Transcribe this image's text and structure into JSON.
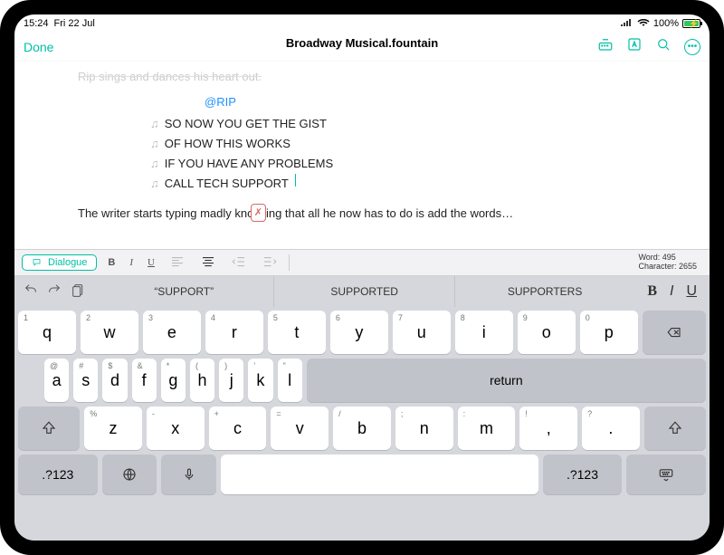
{
  "status": {
    "time": "15:24",
    "date": "Fri 22 Jul",
    "battery_pct": "100%"
  },
  "appbar": {
    "done": "Done",
    "title": "Broadway Musical.fountain"
  },
  "doc": {
    "fade_line": "Rip sings and dances his heart out.",
    "character": "@RIP",
    "lyrics": [
      "SO NOW YOU GET THE GIST",
      "OF HOW THIS WORKS",
      "IF YOU HAVE ANY PROBLEMS",
      "CALL TECH SUPPORT"
    ],
    "action": "The writer starts typing madly knowing that all he now has to do is add the words…"
  },
  "toolbar2": {
    "dialog_label": "Dialogue",
    "word_label": "Word: 495",
    "char_label": "Character: 2655"
  },
  "suggestions": [
    "“SUPPORT”",
    "SUPPORTED",
    "SUPPORTERS"
  ],
  "keys": {
    "row1": [
      {
        "sub": "1",
        "main": "q"
      },
      {
        "sub": "2",
        "main": "w"
      },
      {
        "sub": "3",
        "main": "e"
      },
      {
        "sub": "4",
        "main": "r"
      },
      {
        "sub": "5",
        "main": "t"
      },
      {
        "sub": "6",
        "main": "y"
      },
      {
        "sub": "7",
        "main": "u"
      },
      {
        "sub": "8",
        "main": "i"
      },
      {
        "sub": "9",
        "main": "o"
      },
      {
        "sub": "0",
        "main": "p"
      }
    ],
    "row2": [
      {
        "sub": "@",
        "main": "a"
      },
      {
        "sub": "#",
        "main": "s"
      },
      {
        "sub": "$",
        "main": "d"
      },
      {
        "sub": "&",
        "main": "f"
      },
      {
        "sub": "*",
        "main": "g"
      },
      {
        "sub": "(",
        "main": "h"
      },
      {
        "sub": ")",
        "main": "j"
      },
      {
        "sub": "'",
        "main": "k"
      },
      {
        "sub": "\"",
        "main": "l"
      }
    ],
    "row3": [
      {
        "sub": "%",
        "main": "z"
      },
      {
        "sub": "-",
        "main": "x"
      },
      {
        "sub": "+",
        "main": "c"
      },
      {
        "sub": "=",
        "main": "v"
      },
      {
        "sub": "/",
        "main": "b"
      },
      {
        "sub": ";",
        "main": "n"
      },
      {
        "sub": ":",
        "main": "m"
      },
      {
        "sub": "!",
        "main": ","
      },
      {
        "sub": "?",
        "main": "."
      }
    ],
    "return": "return",
    "numswitch": ".?123"
  }
}
